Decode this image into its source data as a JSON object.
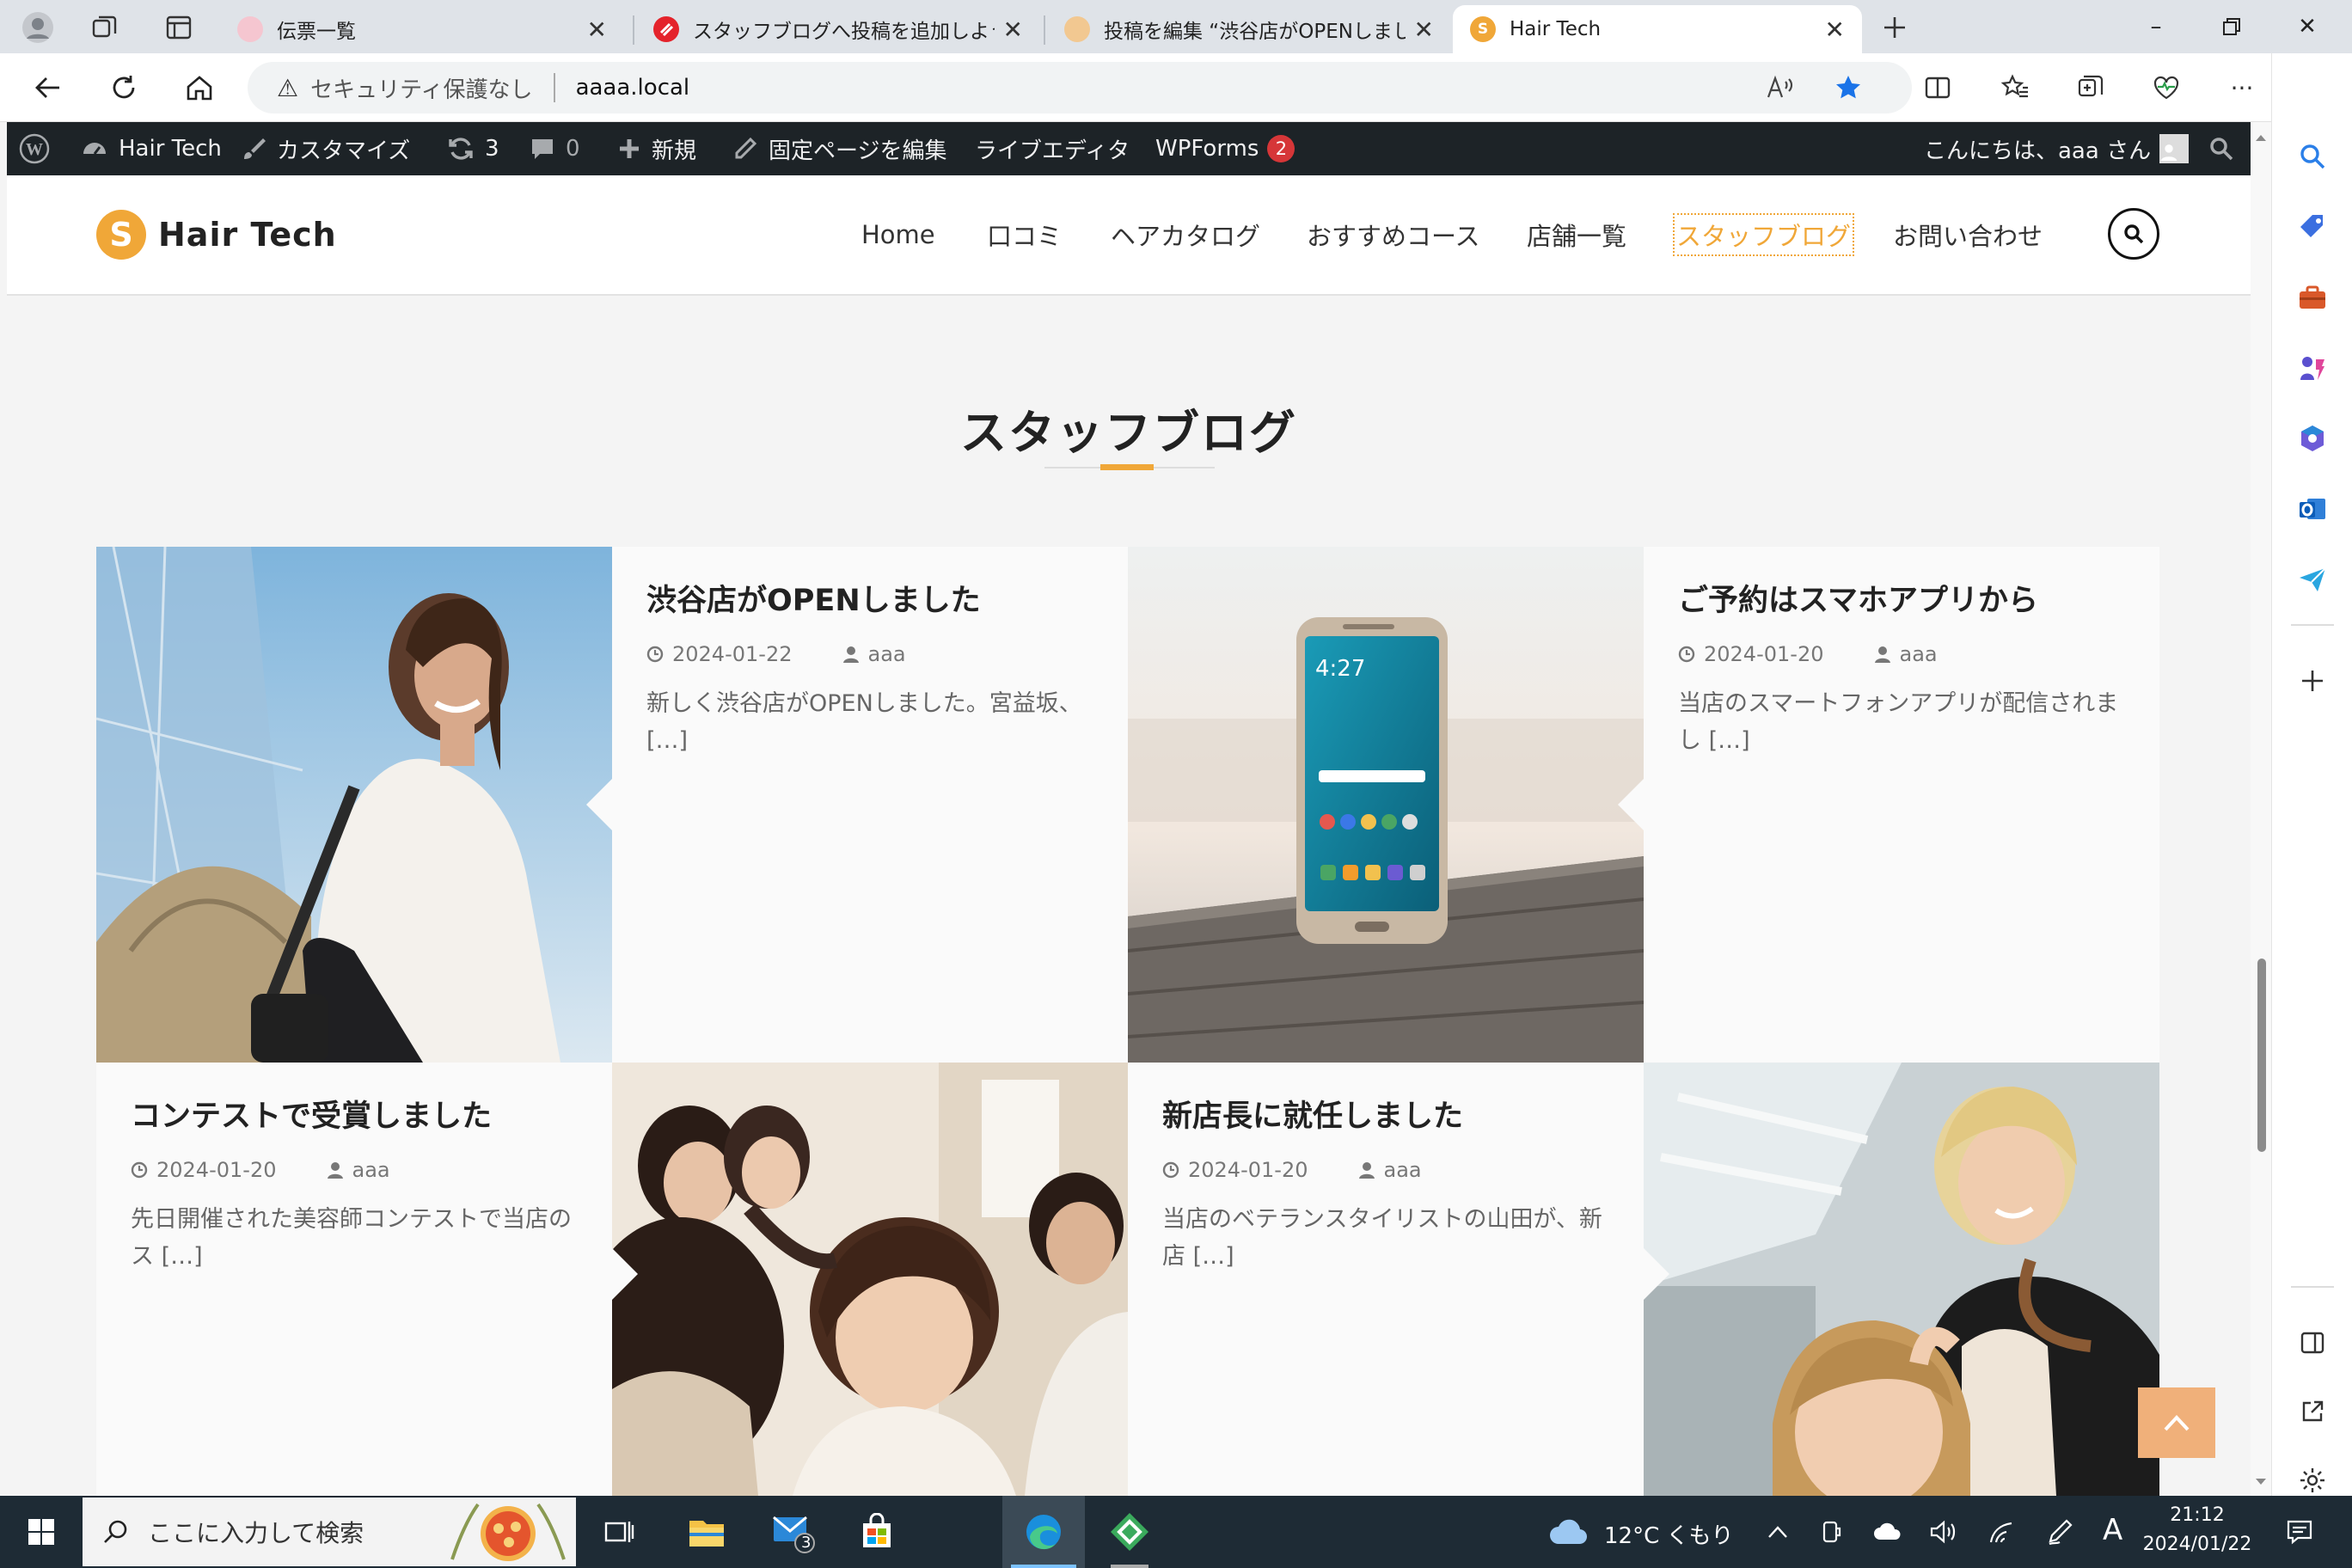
{
  "browser": {
    "tabs": [
      {
        "title": "伝票一覧",
        "active": false
      },
      {
        "title": "スタッフブログへ投稿を追加しよう | ブ",
        "active": false
      },
      {
        "title": "投稿を編集 “渋谷店がOPENしまし",
        "active": false
      },
      {
        "title": "Hair Tech",
        "active": true
      }
    ],
    "security_label": "セキュリティ保護なし",
    "url": "aaaa.local"
  },
  "adminbar": {
    "site_name": "Hair Tech",
    "customize": "カスタマイズ",
    "updates_count": "3",
    "comments_count": "0",
    "new_label": "新規",
    "edit_page": "固定ページを編集",
    "live_editor": "ライブエディタ",
    "wpforms": "WPForms",
    "wpforms_badge": "2",
    "greeting": "こんにちは、aaa さん"
  },
  "site": {
    "logo_text": "Hair Tech",
    "logo_letter": "S",
    "accent_color": "#f0a738",
    "menu": [
      "Home",
      "口コミ",
      "ヘアカタログ",
      "おすすめコース",
      "店舗一覧",
      "スタッフブログ",
      "お問い合わせ"
    ],
    "current_menu": "スタッフブログ"
  },
  "page": {
    "title": "スタッフブログ",
    "posts": [
      {
        "title": "渋谷店がOPENしました",
        "date": "2024-01-22",
        "author": "aaa",
        "excerpt": "新しく渋谷店がOPENしました。宮益坂、[…]"
      },
      {
        "title": "ご予約はスマホアプリから",
        "date": "2024-01-20",
        "author": "aaa",
        "excerpt": "当店のスマートフォンアプリが配信されまし […]"
      },
      {
        "title": "コンテストで受賞しました",
        "date": "2024-01-20",
        "author": "aaa",
        "excerpt": "先日開催された美容師コンテストで当店のス […]"
      },
      {
        "title": "新店長に就任しました",
        "date": "2024-01-20",
        "author": "aaa",
        "excerpt": "当店のベテランスタイリストの山田が、新店 […]"
      }
    ]
  },
  "taskbar": {
    "search_placeholder": "ここに入力して検索",
    "mail_badge": "3",
    "weather": "12°C くもり",
    "ime": "A",
    "time": "21:12",
    "date": "2024/01/22"
  }
}
